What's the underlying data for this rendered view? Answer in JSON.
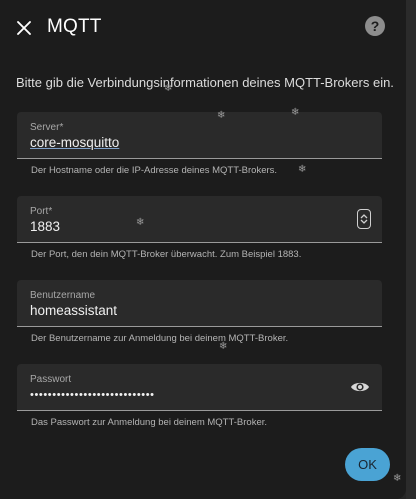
{
  "dialog": {
    "title": "MQTT",
    "close_icon": "close-icon",
    "help_icon": "help-circle-icon",
    "help_glyph": "?",
    "intro": "Bitte gib die Verbindungsinformationen deines MQTT-Brokers ein."
  },
  "fields": {
    "server": {
      "label": "Server*",
      "value": "core-mosquitto",
      "helper": "Der Hostname oder die IP-Adresse deines MQTT-Brokers."
    },
    "port": {
      "label": "Port*",
      "value": "1883",
      "helper": "Der Port, den dein MQTT-Broker überwacht. Zum Beispiel 1883.",
      "icon": "stepper-icon"
    },
    "username": {
      "label": "Benutzername",
      "value": "homeassistant",
      "helper": "Der Benutzername zur Anmeldung bei deinem MQTT-Broker."
    },
    "password": {
      "label": "Passwort",
      "value": "••••••••••••••••••••••••••••",
      "helper": "Das Passwort zur Anmeldung bei deinem MQTT-Broker.",
      "icon": "eye-icon"
    }
  },
  "actions": {
    "ok_label": "OK"
  },
  "decor": {
    "snowflake_glyph": "❄",
    "snowflake_icon": "snowflake-icon"
  },
  "colors": {
    "dialog_bg": "#1c1c1c",
    "field_bg": "#2a2a2a",
    "accent": "#4aa3d4"
  }
}
